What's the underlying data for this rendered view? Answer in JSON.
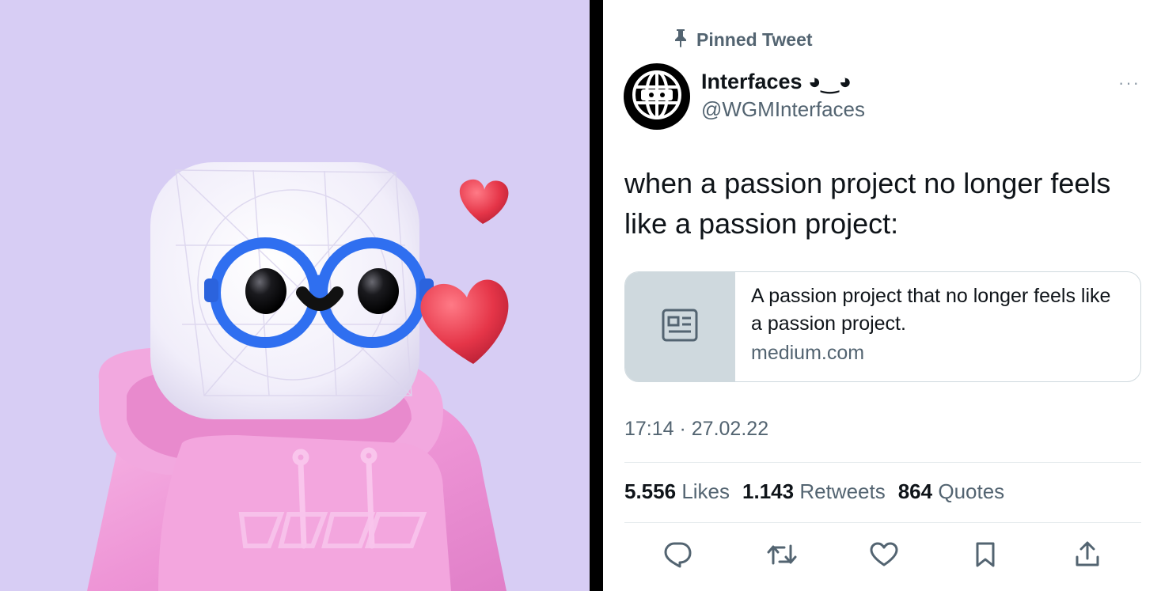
{
  "art": {
    "hoodie_lettering": "Artist logo lettering on hoodie"
  },
  "tweet": {
    "pinned_label": "Pinned Tweet",
    "display_name": "Interfaces ◕‿◕",
    "handle": "@WGMInterfaces",
    "text": "when a passion project no longer feels like a passion project:",
    "card": {
      "title": "A passion project that no longer feels like a passion project.",
      "domain": "medium.com"
    },
    "timestamp": "17:14 · 27.02.22",
    "stats": [
      {
        "value": "5.556",
        "label": "Likes"
      },
      {
        "value": "1.143",
        "label": "Retweets"
      },
      {
        "value": "864",
        "label": "Quotes"
      }
    ],
    "more_label": "···"
  },
  "colors": {
    "art_background": "#d7cdf4",
    "secondary_text": "#536471",
    "primary_text": "#0f1419",
    "border": "#cfd9de"
  },
  "icons": [
    "pin-icon",
    "globe-avatar-icon",
    "more-icon",
    "article-icon",
    "reply-icon",
    "retweet-icon",
    "like-icon",
    "bookmark-icon",
    "share-icon"
  ]
}
